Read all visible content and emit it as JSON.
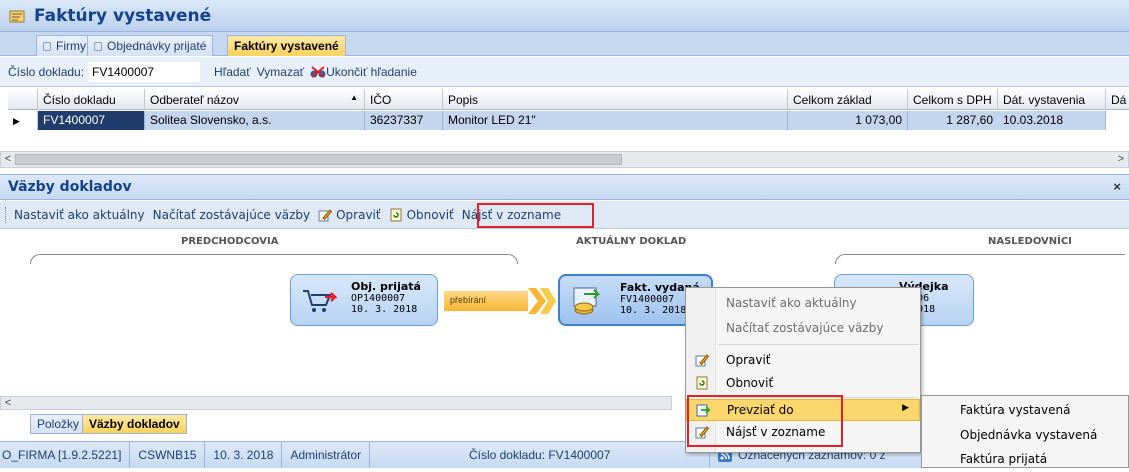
{
  "title": "Faktúry vystavené",
  "tabs": [
    {
      "label": "Firmy"
    },
    {
      "label": "Objednávky prijaté"
    },
    {
      "label": "Faktúry vystavené"
    }
  ],
  "search": {
    "label": "Číslo dokladu:",
    "value": "FV1400007",
    "find": "Hľadať",
    "clear": "Vymazať",
    "end": "Ukončiť hľadanie"
  },
  "grid": {
    "columns": [
      "Číslo dokladu",
      "Odberateľ názov",
      "IČO",
      "Popis",
      "Celkom základ",
      "Celkom s DPH",
      "Dát. vystavenia",
      "Dá"
    ],
    "rows": [
      [
        "FV1400007",
        "Solitea Slovensko, a.s.",
        "36237337",
        "Monitor LED 21\"",
        "1 073,00",
        "1 287,60",
        "10.03.2018",
        ""
      ]
    ]
  },
  "panel": {
    "title": "Väzby dokladov",
    "close": "×"
  },
  "toolbar": {
    "set_current": "Nastaviť ako aktuálny",
    "load_rest": "Načítať zostávajúce väzby",
    "edit": "Opraviť",
    "refresh": "Obnoviť",
    "find_in_list": "Nájsť v zozname"
  },
  "diagram": {
    "predecessors": "PREDCHODCOVIA",
    "current": "AKTUÁLNY DOKLAD",
    "successors": "NASLEDOVNÍCI",
    "node1": {
      "title": "Obj. prijatá",
      "number": "OP1400007",
      "date": "10. 3. 2018"
    },
    "flow": "přebírání",
    "node2": {
      "title": "Fakt. vydaná",
      "number": "FV1400007",
      "date": "10. 3. 2018"
    },
    "node3": {
      "title": "Výdejka",
      "number": "00006",
      "date": ". 2018"
    }
  },
  "bottom_tabs": [
    "Položky",
    "Väzby dokladov"
  ],
  "status": {
    "firm": "O_FIRMA [1.9.2.5221]",
    "station": "CSWNB15",
    "date": "10. 3. 2018",
    "user": "Administrátor",
    "doc": "Číslo dokladu: FV1400007",
    "marked": "Označených záznamov: 0 z"
  },
  "context_menu": {
    "items": [
      "Nastaviť ako aktuálny",
      "Načítať zostávajúce väzby",
      "Opraviť",
      "Obnoviť",
      "Prevziať do",
      "Nájsť v zozname"
    ]
  },
  "submenu": {
    "items": [
      "Faktúra vystavená",
      "Objednávka vystavená",
      "Faktúra prijatá"
    ]
  },
  "colors": {
    "accent": "#15428b",
    "highlight": "#fbd66c",
    "redbox": "#e0202a",
    "selected": "#1f3c6c"
  }
}
